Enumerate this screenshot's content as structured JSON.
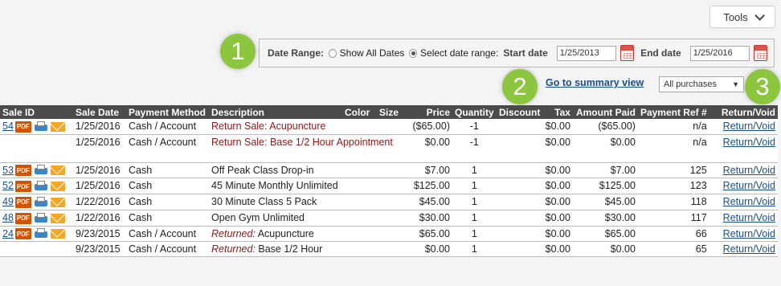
{
  "toolbar": {
    "tools_label": "Tools",
    "chevron_icon": "chevron-down-icon"
  },
  "badges": [
    "1",
    "2",
    "3"
  ],
  "filter": {
    "date_range_label": "Date Range:",
    "option_all": "Show All Dates",
    "option_select": "Select date range:",
    "selected_option": "Select date range:",
    "start_label": "Start date",
    "start_value": "1/25/2013",
    "end_label": "End date",
    "end_value": "1/25/2016"
  },
  "links": {
    "summary": "Go to summary view"
  },
  "purchase_filter": {
    "selected": "All purchases",
    "arrow": "▼"
  },
  "table": {
    "headers": {
      "sale_id": "Sale ID",
      "sale_date": "Sale Date",
      "payment_method": "Payment Method",
      "description": "Description",
      "color": "Color",
      "size": "Size",
      "price": "Price",
      "quantity": "Quantity",
      "discount": "Discount",
      "tax": "Tax",
      "amount_paid": "Amount Paid",
      "payment_ref": "Payment Ref #",
      "return_void": "Return/Void"
    },
    "icon_labels": {
      "pdf": "PDF"
    },
    "rows": [
      {
        "sale_id": "54",
        "date": "1/25/2016",
        "method": "Cash / Account",
        "desc_prefix": "",
        "desc": "Return Sale: Acupuncture",
        "price": "($65.00)",
        "qty": "-1",
        "discount": "",
        "tax": "$0.00",
        "paid": "($65.00)",
        "ref": "n/a",
        "action": "Return/Void"
      },
      {
        "sale_id": "",
        "date": "1/25/2016",
        "method": "Cash / Account",
        "desc_prefix": "",
        "desc": "Return Sale: Base 1/2 Hour Appointment",
        "price": "$0.00",
        "qty": "-1",
        "discount": "",
        "tax": "$0.00",
        "paid": "$0.00",
        "ref": "n/a",
        "action": "Return/Void"
      },
      {
        "sale_id": "53",
        "date": "1/25/2016",
        "method": "Cash",
        "desc_prefix": "",
        "desc": "Off Peak Class Drop-in",
        "price": "$7.00",
        "qty": "1",
        "discount": "",
        "tax": "$0.00",
        "paid": "$7.00",
        "ref": "125",
        "action": "Return/Void"
      },
      {
        "sale_id": "52",
        "date": "1/25/2016",
        "method": "Cash",
        "desc_prefix": "",
        "desc": "45 Minute Monthly Unlimited",
        "price": "$125.00",
        "qty": "1",
        "discount": "",
        "tax": "$0.00",
        "paid": "$125.00",
        "ref": "123",
        "action": "Return/Void"
      },
      {
        "sale_id": "49",
        "date": "1/22/2016",
        "method": "Cash",
        "desc_prefix": "",
        "desc": "30 Minute Class 5 Pack",
        "price": "$45.00",
        "qty": "1",
        "discount": "",
        "tax": "$0.00",
        "paid": "$45.00",
        "ref": "118",
        "action": "Return/Void"
      },
      {
        "sale_id": "48",
        "date": "1/22/2016",
        "method": "Cash",
        "desc_prefix": "",
        "desc": "Open Gym Unlimited",
        "price": "$30.00",
        "qty": "1",
        "discount": "",
        "tax": "$0.00",
        "paid": "$30.00",
        "ref": "117",
        "action": "Return/Void"
      },
      {
        "sale_id": "24",
        "date": "9/23/2015",
        "method": "Cash / Account",
        "desc_prefix": "Returned:",
        "desc": " Acupuncture",
        "price": "$65.00",
        "qty": "1",
        "discount": "",
        "tax": "$0.00",
        "paid": "$65.00",
        "ref": "66",
        "action": "Return/Void"
      },
      {
        "sale_id": "",
        "date": "9/23/2015",
        "method": "Cash / Account",
        "desc_prefix": "Returned:",
        "desc": " Base 1/2 Hour",
        "price": "$0.00",
        "qty": "1",
        "discount": "",
        "tax": "$0.00",
        "paid": "$0.00",
        "ref": "65",
        "action": "Return/Void"
      }
    ]
  }
}
